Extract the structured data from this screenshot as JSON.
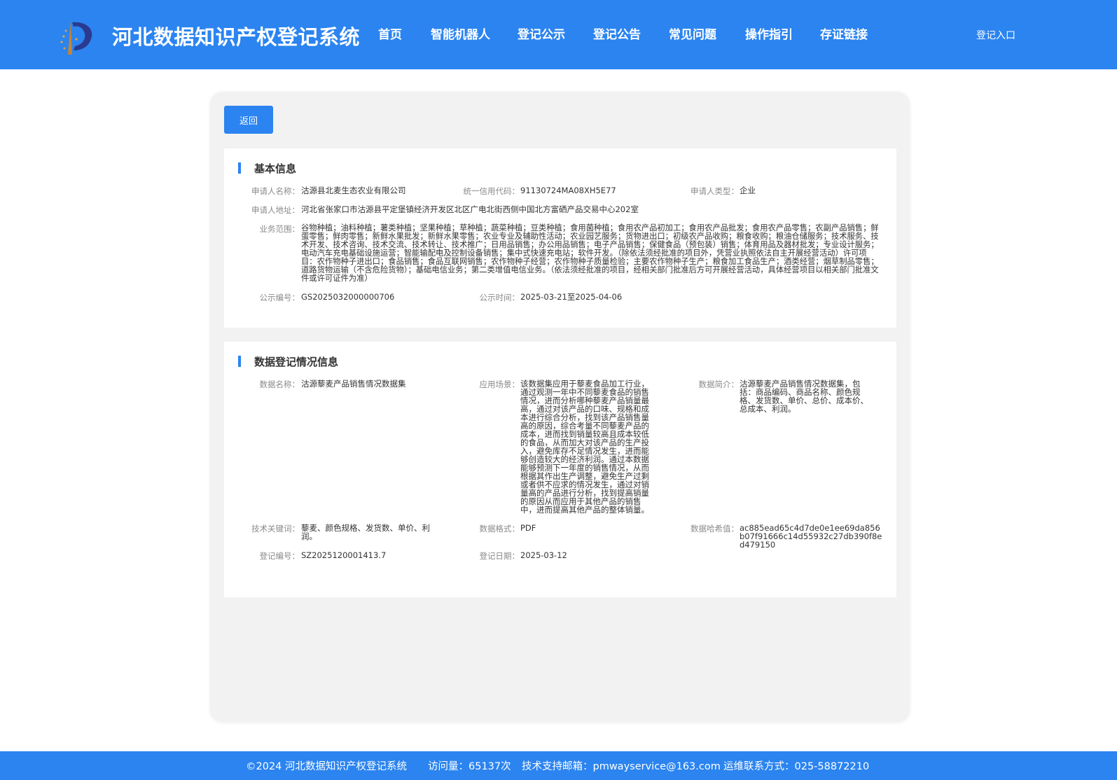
{
  "header": {
    "site_title": "河北数据知识产权登记系统",
    "nav": [
      {
        "label": "首页"
      },
      {
        "label": "智能机器人"
      },
      {
        "label": "登记公示"
      },
      {
        "label": "登记公告"
      },
      {
        "label": "常见问题"
      },
      {
        "label": "操作指引"
      },
      {
        "label": "存证链接"
      }
    ],
    "login_label": "登记入口"
  },
  "back_label": "返回",
  "basic_info": {
    "title": "基本信息",
    "applicant_name": {
      "label": "申请人名称：",
      "value": "沽源县北麦生态农业有限公司"
    },
    "credit_code": {
      "label": "统一信用代码：",
      "value": "91130724MA08XH5E77"
    },
    "applicant_type": {
      "label": "申请人类型：",
      "value": "企业"
    },
    "address": {
      "label": "申请人地址：",
      "value": "河北省张家口市沽源县平定堡镇经济开发区北区广电北街西侧中国北方富硒产品交易中心202室"
    },
    "business_scope": {
      "label": "业务范围：",
      "value": "谷物种植；油料种植；薯类种植；坚果种植；草种植；蔬菜种植；豆类种植；食用菌种植；食用农产品初加工；食用农产品批发；食用农产品零售；农副产品销售；鲜蛋零售；鲜肉零售；新鲜水果批发；新鲜水果零售；农业专业及辅助性活动；农业园艺服务；货物进出口；初级农产品收购；粮食收购；粮油仓储服务；技术服务、技术开发、技术咨询、技术交流、技术转让、技术推广；日用品销售；办公用品销售；电子产品销售；保健食品（预包装）销售；体育用品及器材批发；专业设计服务；电动汽车充电基础设施运营；智能输配电及控制设备销售；集中式快速充电站；软件开发。（除依法须经批准的项目外，凭营业执照依法自主开展经营活动）许可项目：农作物种子进出口；食品销售；食品互联网销售；农作物种子经营；农作物种子质量检验；主要农作物种子生产；粮食加工食品生产；酒类经营；烟草制品零售；道路货物运输（不含危险货物）；基础电信业务；第二类增值电信业务。（依法须经批准的项目，经相关部门批准后方可开展经营活动，具体经营项目以相关部门批准文件或许可证件为准）"
    },
    "notice_no": {
      "label": "公示编号：",
      "value": "GS2025032000000706"
    },
    "notice_time": {
      "label": "公示时间：",
      "value": "2025-03-21至2025-04-06"
    }
  },
  "data_info": {
    "title": "数据登记情况信息",
    "data_name": {
      "label": "数据名称：",
      "value": "沽源藜麦产品销售情况数据集"
    },
    "scenario": {
      "label": "应用场景：",
      "value": "该数据集应用于藜麦食品加工行业，通过观测一年中不同藜麦食品的销售情况，进而分析哪种藜麦产品销量最高，通过对该产品的口味、规格和成本进行综合分析，找到该产品销售量高的原因，综合考量不同藜麦产品的成本，进而找到销量较高且成本较低的食品，从而加大对该产品的生产投入，避免库存不足情况发生，进而能够创造较大的经济利润。通过本数据能够预测下一年度的销售情况，从而根据其作出生产调整，避免生产过剩或者供不应求的情况发生，通过对销量高的产品进行分析，找到提高销量的原因从而应用于其他产品的销售中，进而提高其他产品的整体销量。"
    },
    "summary": {
      "label": "数据简介：",
      "value": "沽源藜麦产品销售情况数据集，包括：商品编码、商品名称、颜色规格、发货数、单价、总价、成本价、总成本、利润。"
    },
    "keywords": {
      "label": "技术关键词：",
      "value": "藜麦、颜色规格、发货数、单价、利润。"
    },
    "format": {
      "label": "数据格式：",
      "value": "PDF"
    },
    "hash": {
      "label": "数据哈希值：",
      "value": "ac885ead65c4d7de0e1ee69da856b07f91666c14d55932c27db390f8ed479150"
    },
    "reg_no": {
      "label": "登记编号：",
      "value": "SZ2025120001413.7"
    },
    "reg_date": {
      "label": "登记日期：",
      "value": "2025-03-12"
    }
  },
  "footer": {
    "copyright": "©2024 河北数据知识产权登记系统",
    "visits": "访问量：65137次",
    "email": "技术支持邮箱：pmwayservice@163.com",
    "phone": "运维联系方式：025-58872210"
  },
  "colors": {
    "primary": "#2b84f0",
    "panel_bg": "#f2f2f2"
  }
}
